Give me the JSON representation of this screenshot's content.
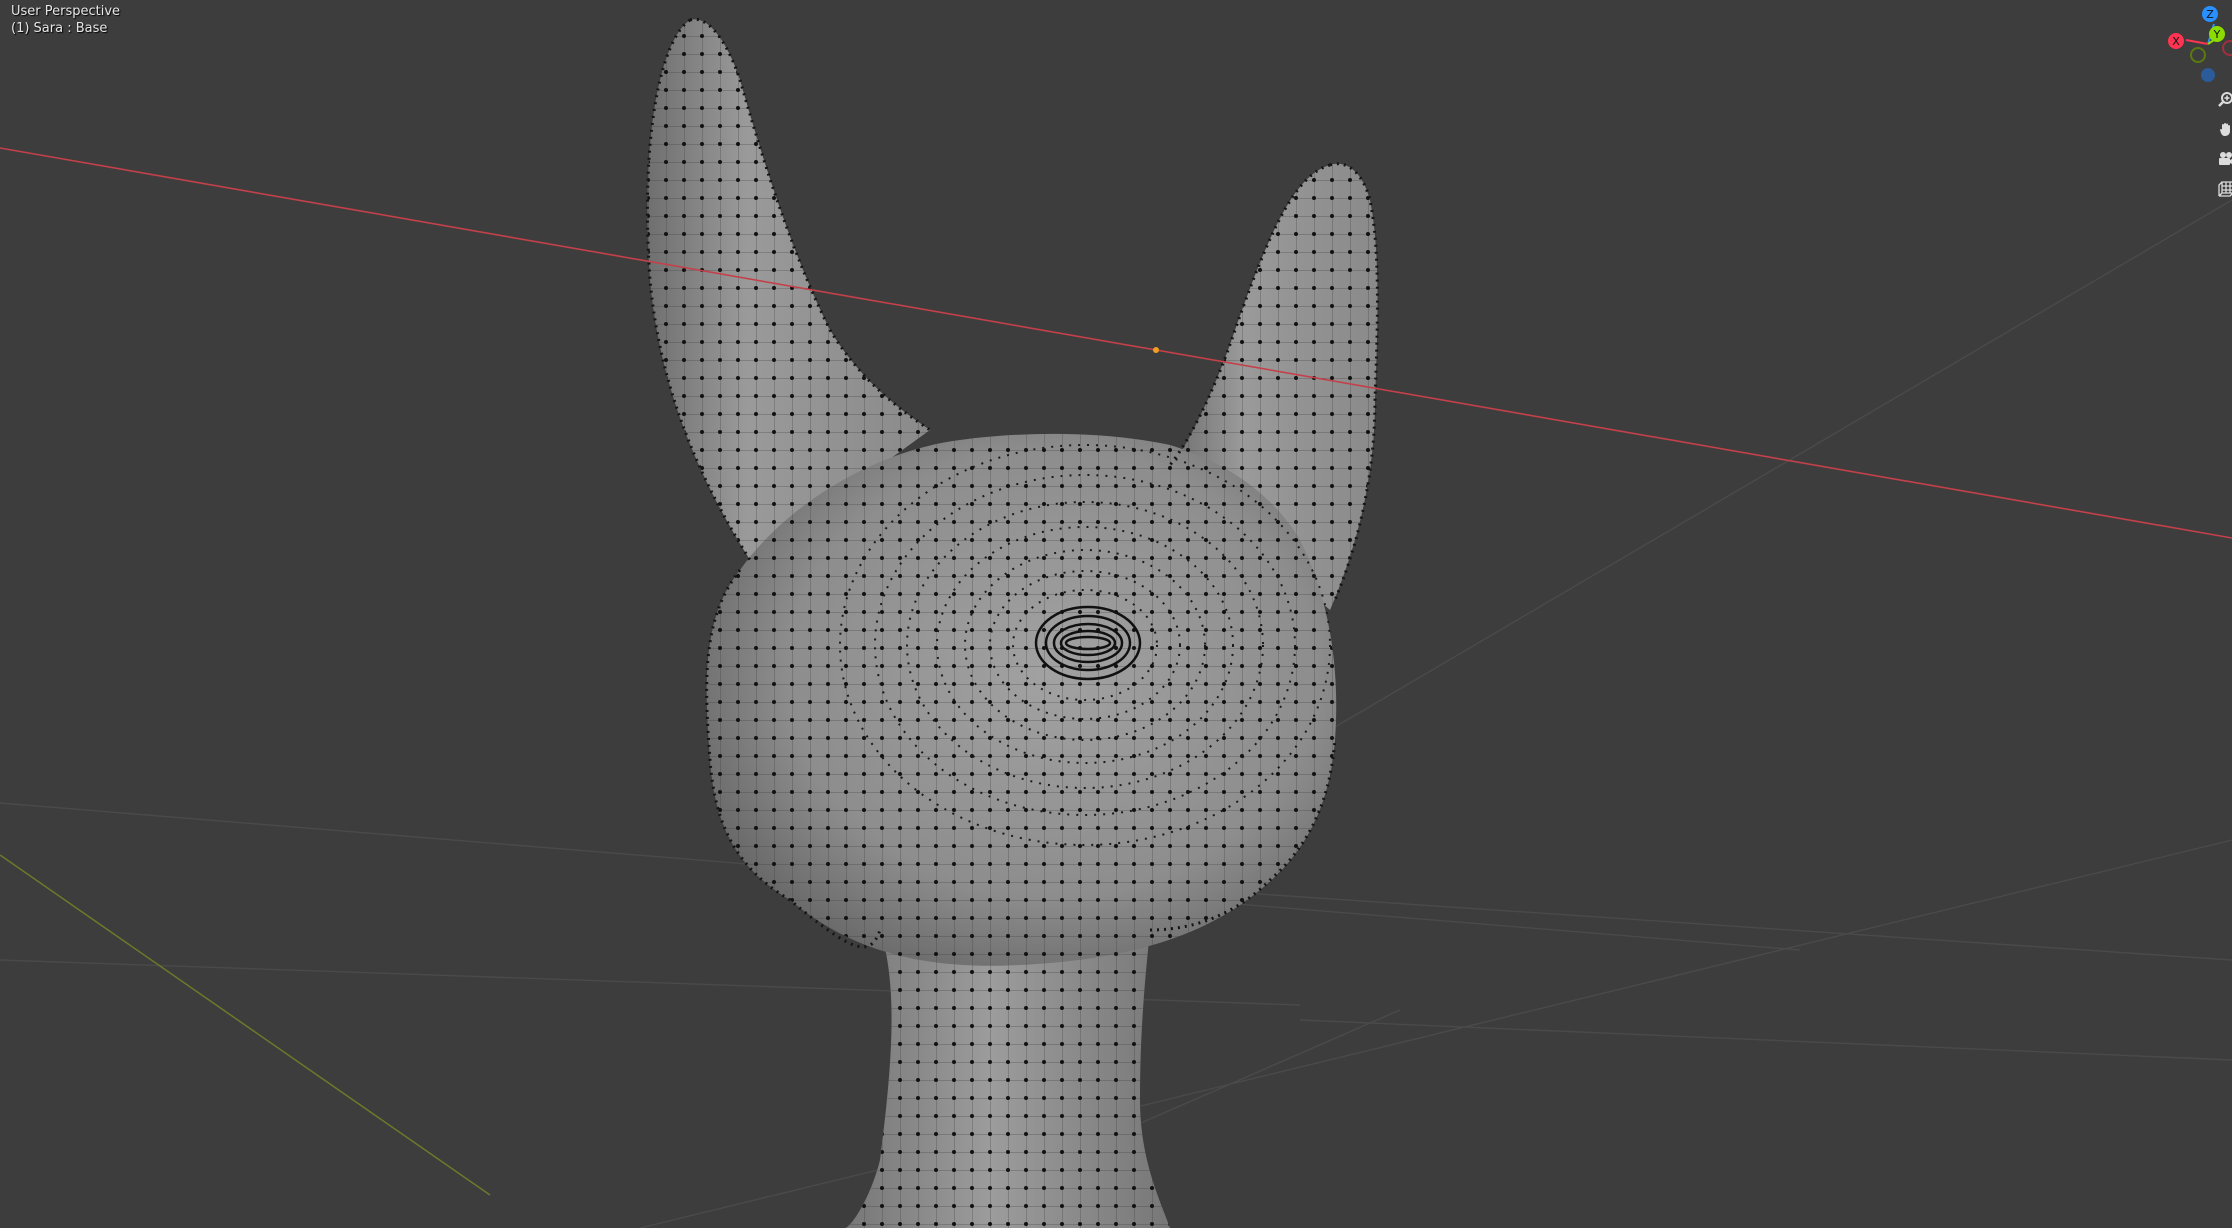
{
  "viewport": {
    "view_name": "User Perspective",
    "object_info": "(1) Sara : Base",
    "background_color": "#3d3d3d",
    "mesh_color": "#8e8e8e",
    "x_axis_color": "#ff3352",
    "y_axis_color": "#8bdc00",
    "z_axis_color": "#2890ff"
  },
  "gizmo": {
    "axes": {
      "z": "Z",
      "y": "Y",
      "x": "X"
    }
  },
  "nav_buttons": {
    "zoom": "zoom-icon",
    "pan": "hand-icon",
    "camera": "camera-icon",
    "ortho": "grid-icon"
  }
}
